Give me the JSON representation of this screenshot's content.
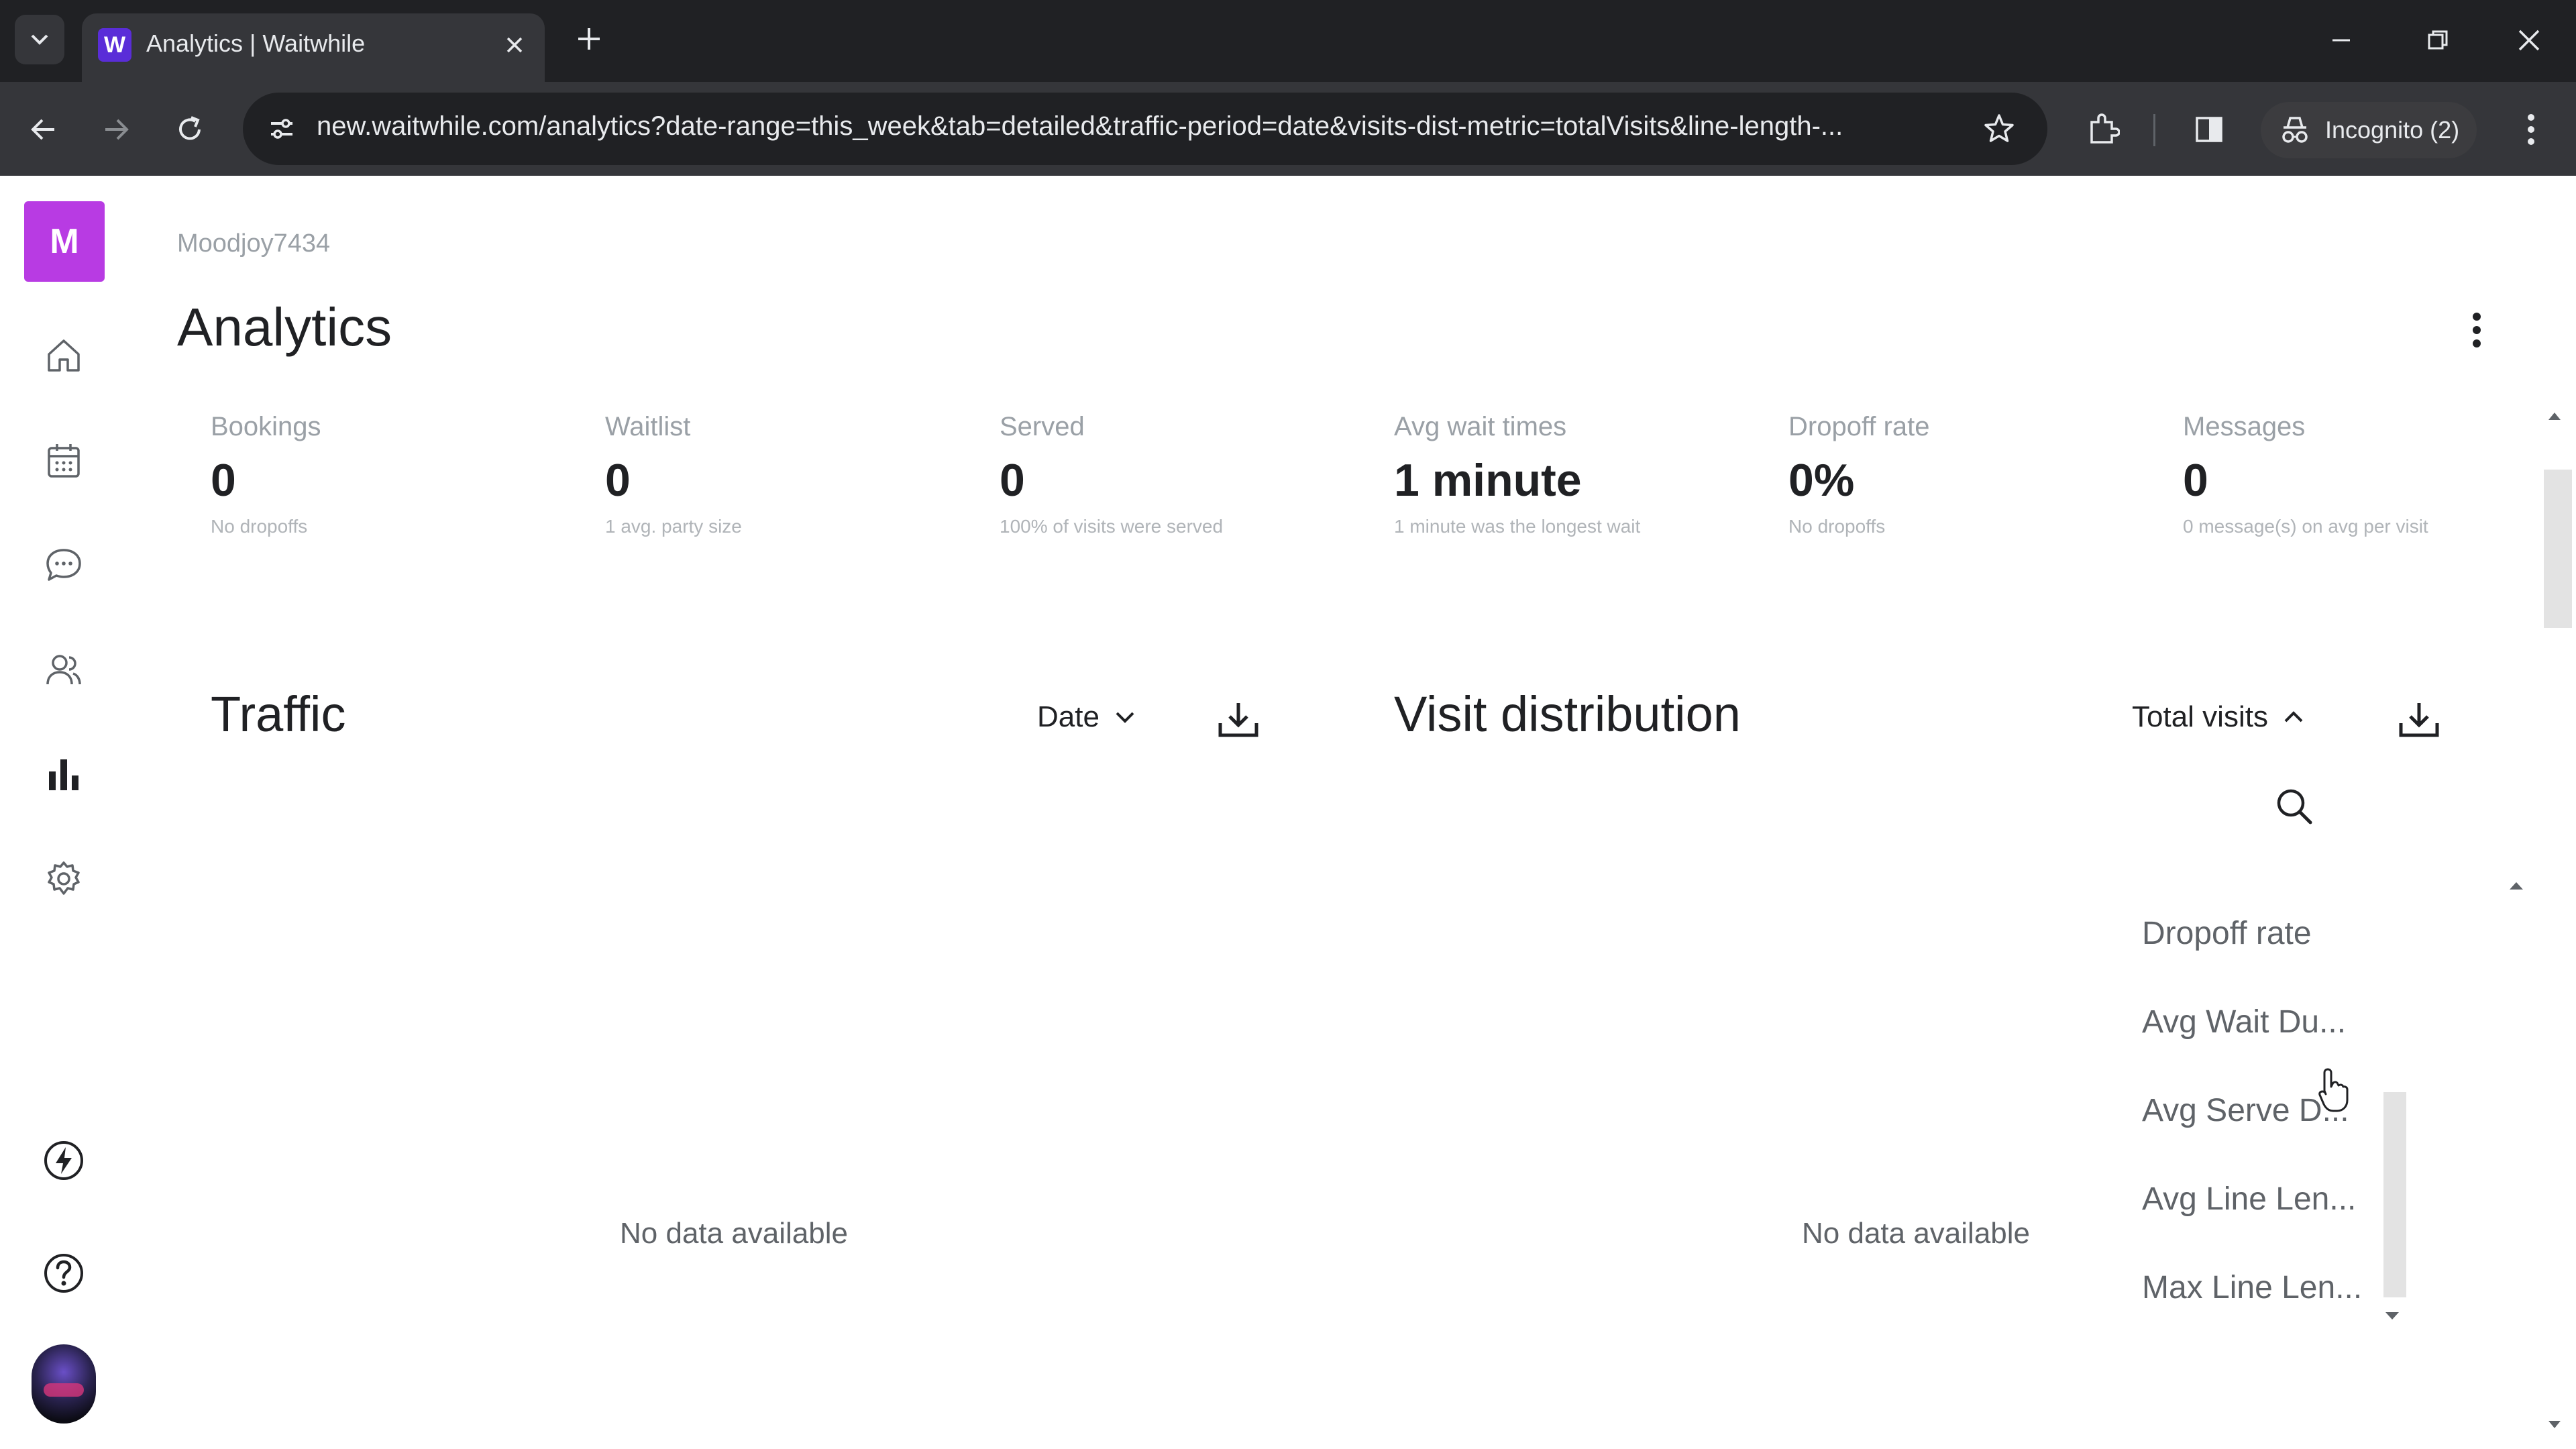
{
  "browser": {
    "tab_title": "Analytics | Waitwhile",
    "favicon_letter": "W",
    "url": "new.waitwhile.com/analytics?date-range=this_week&tab=detailed&traffic-period=date&visits-dist-metric=totalVisits&line-length-...",
    "incognito_label": "Incognito (2)"
  },
  "rail": {
    "logo_letter": "M",
    "items": [
      "home-icon",
      "calendar-icon",
      "chat-icon",
      "people-icon",
      "analytics-icon",
      "settings-icon"
    ],
    "bottom": [
      "lightning-icon",
      "help-icon"
    ]
  },
  "header": {
    "account": "Moodjoy7434",
    "title": "Analytics"
  },
  "stats": [
    {
      "label": "Bookings",
      "value": "0",
      "sub": "No dropoffs"
    },
    {
      "label": "Waitlist",
      "value": "0",
      "sub": "1 avg. party size"
    },
    {
      "label": "Served",
      "value": "0",
      "sub": "100% of visits were served"
    },
    {
      "label": "Avg wait times",
      "value": "1 minute",
      "sub": "1 minute was the longest wait"
    },
    {
      "label": "Dropoff rate",
      "value": "0%",
      "sub": "No dropoffs"
    },
    {
      "label": "Messages",
      "value": "0",
      "sub": "0 message(s) on avg per visit"
    }
  ],
  "traffic": {
    "title": "Traffic",
    "period_label": "Date",
    "empty_text": "No data available"
  },
  "visit_distribution": {
    "title": "Visit distribution",
    "metric_label": "Total visits",
    "empty_text": "No data available",
    "menu_items": [
      "Dropoff rate",
      "Avg Wait Du...",
      "Avg Serve D...",
      "Avg Line Len...",
      "Max Line Len..."
    ]
  },
  "colors": {
    "brand_purple": "#b83be3",
    "chrome_dark": "#202124",
    "chrome_toolbar": "#35363a"
  }
}
